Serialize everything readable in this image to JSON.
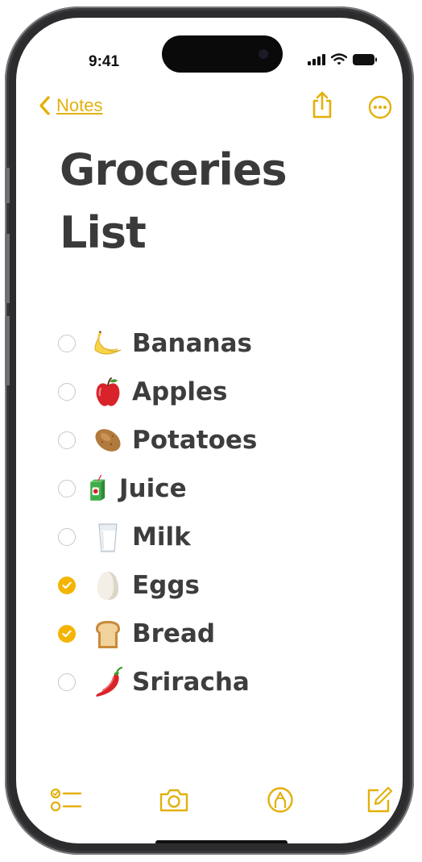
{
  "status_bar": {
    "time": "9:41",
    "icons": [
      "cellular-signal-icon",
      "wifi-icon",
      "battery-icon"
    ]
  },
  "nav": {
    "back_label": "Notes",
    "back_icon": "chevron-left-icon",
    "share_icon": "share-icon",
    "more_icon": "ellipsis-circle-icon"
  },
  "note": {
    "title_line1": "Groceries",
    "title_line2": "List",
    "items": [
      {
        "label": "Bananas",
        "emoji": "banana",
        "checked": false
      },
      {
        "label": "Apples",
        "emoji": "red-apple",
        "checked": false
      },
      {
        "label": "Potatoes",
        "emoji": "potato",
        "checked": false
      },
      {
        "label": "Juice",
        "emoji": "juice-box",
        "checked": false
      },
      {
        "label": "Milk",
        "emoji": "glass-of-milk",
        "checked": false
      },
      {
        "label": "Eggs",
        "emoji": "egg",
        "checked": true
      },
      {
        "label": "Bread",
        "emoji": "bread",
        "checked": true
      },
      {
        "label": "Sriracha",
        "emoji": "hot-pepper",
        "checked": false
      }
    ]
  },
  "toolbar": {
    "icons": [
      "checklist-icon",
      "camera-icon",
      "markup-pen-icon",
      "compose-icon"
    ]
  },
  "colors": {
    "accent": "#e3b00c",
    "checked_fill": "#f4b400",
    "text": "#3d3d3d",
    "unchecked_border": "#c7c7cc"
  }
}
